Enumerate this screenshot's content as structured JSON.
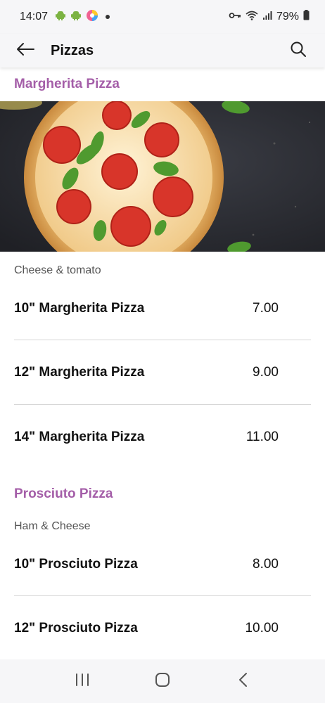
{
  "status_bar": {
    "time": "14:07",
    "battery": "79%",
    "icons": [
      "android-icon",
      "android-icon",
      "app-icon",
      "vpn-key-icon",
      "wifi-icon",
      "signal-icon",
      "battery-icon"
    ]
  },
  "header": {
    "title": "Pizzas"
  },
  "sections": [
    {
      "title": "Margherita Pizza",
      "description": "Cheese & tomato",
      "items": [
        {
          "name": "10\" Margherita Pizza",
          "price": "7.00"
        },
        {
          "name": "12\" Margherita Pizza",
          "price": "9.00"
        },
        {
          "name": "14\" Margherita Pizza",
          "price": "11.00"
        }
      ]
    },
    {
      "title": "Prosciuto Pizza",
      "description": "Ham & Cheese",
      "items": [
        {
          "name": "10\" Prosciuto Pizza",
          "price": "8.00"
        },
        {
          "name": "12\" Prosciuto Pizza",
          "price": "10.00"
        }
      ]
    }
  ],
  "colors": {
    "accent": "#a45ea8",
    "bar_background": "#f6f6f8"
  },
  "nav_bar": {
    "icons": [
      "recent-apps-icon",
      "home-icon",
      "back-nav-icon"
    ]
  }
}
